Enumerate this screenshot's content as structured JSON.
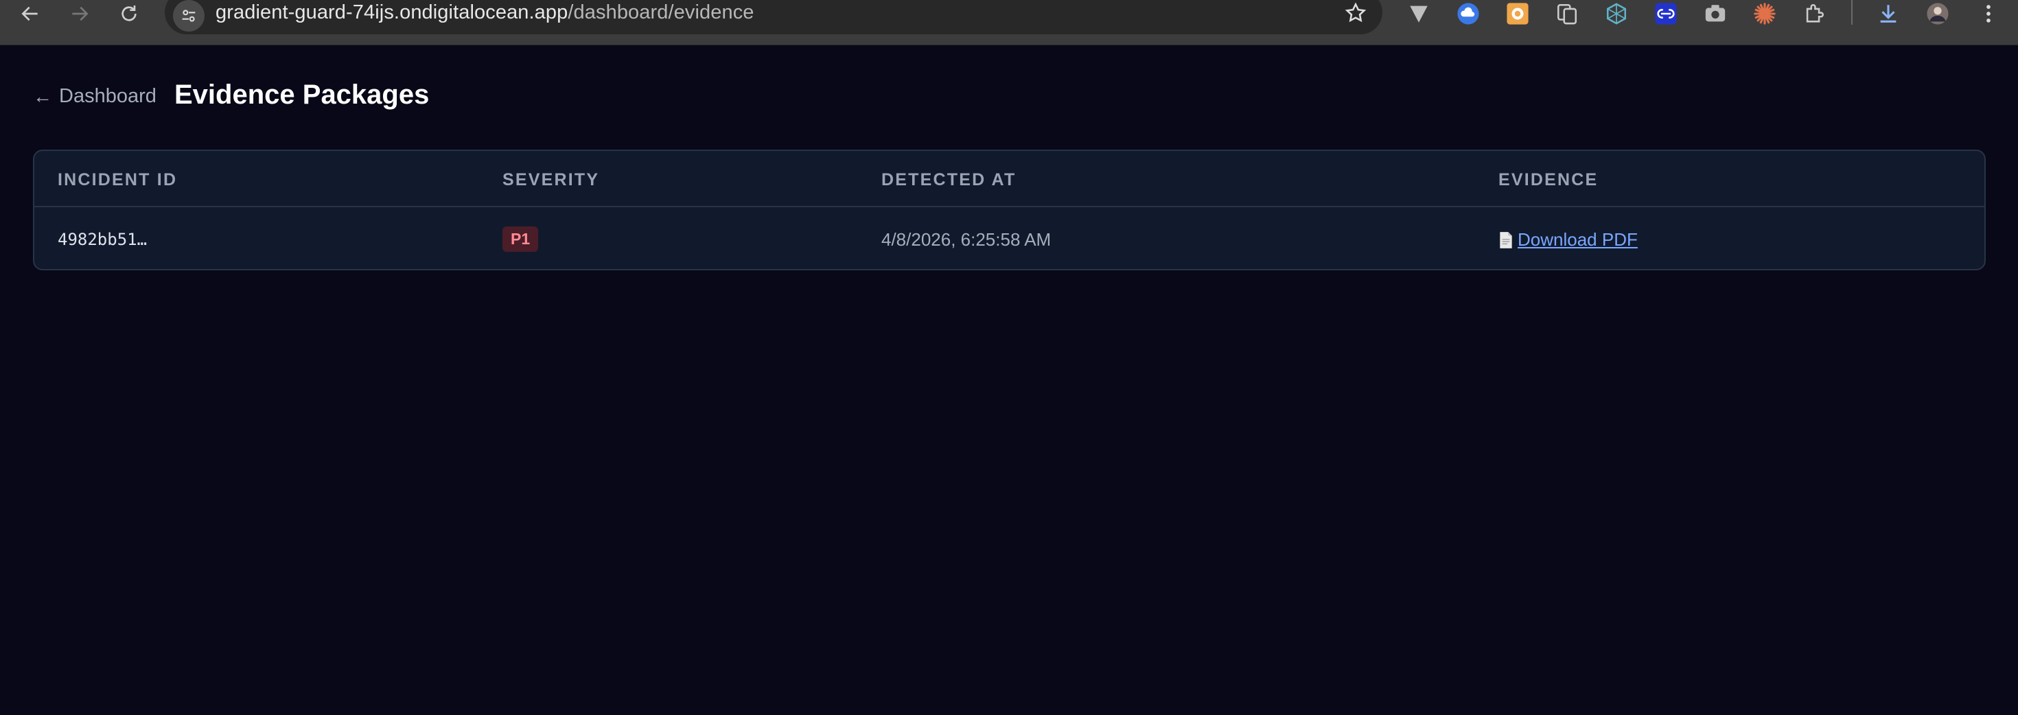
{
  "browser": {
    "url_host": "gradient-guard-74ijs.ondigitalocean.app",
    "url_path": "/dashboard/evidence",
    "nav_icons": [
      "back-arrow-icon",
      "forward-arrow-icon",
      "reload-icon"
    ],
    "extension_icons": [
      "vivaldi-v-icon",
      "cloud-upload-icon",
      "orange-clock-icon",
      "copy-docs-icon",
      "hexagon-network-icon",
      "blue-link-icon",
      "camera-icon",
      "orange-burst-icon",
      "puzzle-piece-icon",
      "download-icon",
      "profile-avatar-icon",
      "kebab-menu-icon"
    ]
  },
  "page": {
    "back_label": "Dashboard",
    "title": "Evidence Packages"
  },
  "table": {
    "columns": [
      "INCIDENT ID",
      "SEVERITY",
      "DETECTED AT",
      "EVIDENCE"
    ],
    "rows": [
      {
        "incident_id": "4982bb51…",
        "severity": "P1",
        "detected_at": "4/8/2026, 6:25:58 AM",
        "evidence_label": "Download PDF",
        "evidence_icon": "file-icon"
      }
    ]
  },
  "colors": {
    "background": "#080818",
    "card": "#111a2c",
    "severity_p1_bg": "#4a1d28",
    "severity_p1_text": "#ff8a96",
    "link": "#7aa7ff"
  }
}
